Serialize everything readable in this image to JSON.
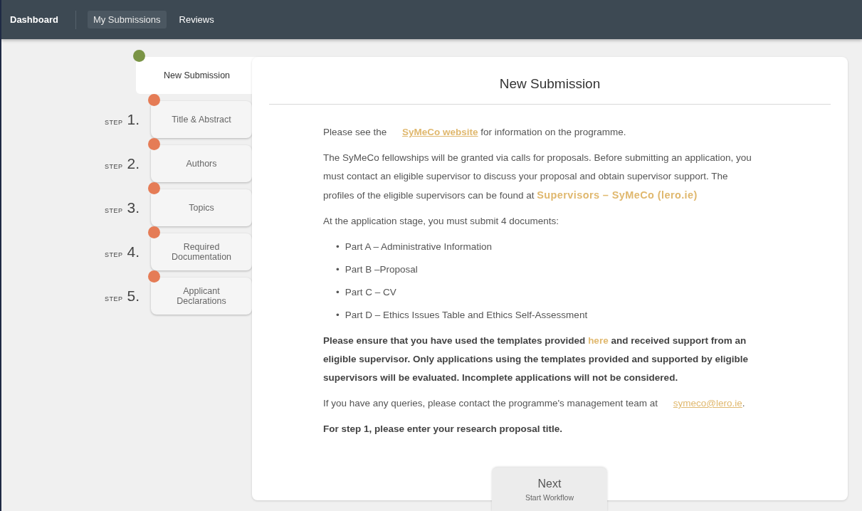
{
  "nav": {
    "brand": "Dashboard",
    "items": [
      {
        "label": "My Submissions",
        "selected": true
      },
      {
        "label": "Reviews",
        "selected": false
      }
    ]
  },
  "steps": [
    {
      "label": "New Submission",
      "selected": true,
      "color": "#7a9445"
    },
    {
      "step_word": "STEP",
      "number": "1.",
      "label": "Title & Abstract",
      "selected": false,
      "color": "#e57c56"
    },
    {
      "step_word": "STEP",
      "number": "2.",
      "label": "Authors",
      "selected": false,
      "color": "#e57c56"
    },
    {
      "step_word": "STEP",
      "number": "3.",
      "label": "Topics",
      "selected": false,
      "color": "#e57c56"
    },
    {
      "step_word": "STEP",
      "number": "4.",
      "label": "Required Documentation",
      "selected": false,
      "color": "#e57c56"
    },
    {
      "step_word": "STEP",
      "number": "5.",
      "label": "Applicant Declarations",
      "selected": false,
      "color": "#e57c56"
    }
  ],
  "card": {
    "title": "New Submission",
    "paragraphs": [
      {
        "kind": "text",
        "parts": [
          {
            "text": "Please see the "
          },
          {
            "text": "SyMeCo website",
            "link": true,
            "bold": true,
            "underline": true
          },
          {
            "text": " for information on the programme."
          }
        ]
      },
      {
        "kind": "text",
        "parts": [
          {
            "text": "The SyMeCo fellowships will be granted via calls for proposals. Before submitting an application, you must contact an eligible supervisor to discuss your proposal and obtain supervisor support. The profiles of the eligible supervisors can be found at "
          },
          {
            "text": "Supervisors – SyMeCo (lero.ie)",
            "link": true,
            "bold": true,
            "underline": false
          }
        ]
      },
      {
        "kind": "text",
        "parts": [
          {
            "text": "At the application stage, you must submit 4 documents:"
          }
        ]
      },
      {
        "kind": "list",
        "items": [
          {
            "marker": "•",
            "text": "Part A – Administrative Information"
          },
          {
            "marker": "•",
            "text": "Part B –Proposal"
          },
          {
            "marker": "•",
            "text": "Part C – CV"
          },
          {
            "marker": "•",
            "text": "Part D – Ethics Issues Table and Ethics Self-Assessment"
          }
        ]
      },
      {
        "kind": "bold",
        "parts": [
          {
            "text": "Please ensure that you have used the templates provided "
          },
          {
            "text": "here",
            "link": true,
            "bold": false,
            "underline": false
          },
          {
            "text": " and received support from an eligible supervisor. Only applications using the templates provided and supported by eligible supervisors will be evaluated. Incomplete applications will not be considered."
          }
        ]
      },
      {
        "kind": "text",
        "parts": [
          {
            "text": "If you have any queries, please contact the programme's management team at "
          },
          {
            "text": "symeco@lero.ie",
            "link": true,
            "bold": false,
            "underline": true
          },
          {
            "text": "."
          }
        ]
      },
      {
        "kind": "bold",
        "parts": [
          {
            "text": "For step 1, please enter your research proposal title."
          }
        ]
      }
    ],
    "next": {
      "label": "Next",
      "sublabel": "Start Workflow"
    }
  }
}
